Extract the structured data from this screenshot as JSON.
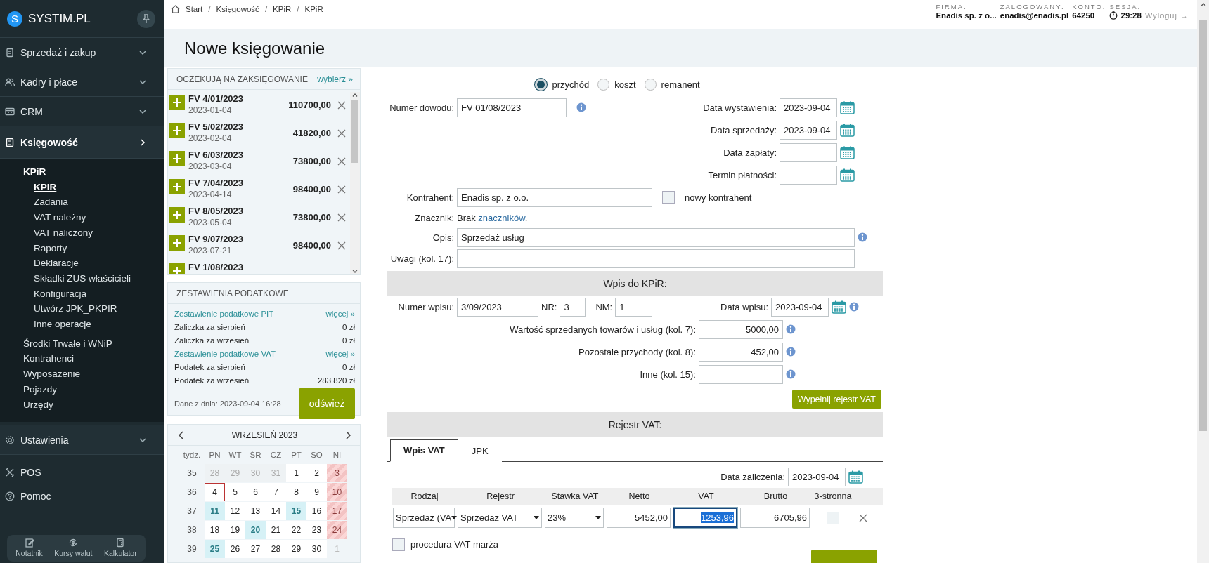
{
  "sidebar": {
    "logo": {
      "mark": "S",
      "name": "SYSTIM.PL"
    },
    "menu": [
      {
        "label": "Sprzedaż i zakup",
        "expanded": false
      },
      {
        "label": "Kadry i płace",
        "expanded": false
      },
      {
        "label": "CRM",
        "expanded": false
      },
      {
        "label": "Księgowość",
        "expanded": true,
        "children": [
          {
            "label": "KPiR",
            "selected": false,
            "children": [
              {
                "label": "KPiR",
                "selected": true
              },
              {
                "label": "Zadania",
                "selected": false
              },
              {
                "label": "VAT należny",
                "selected": false
              },
              {
                "label": "VAT naliczony",
                "selected": false
              },
              {
                "label": "Raporty",
                "selected": false
              },
              {
                "label": "Deklaracje",
                "selected": false
              },
              {
                "label": "Składki ZUS właścicieli",
                "selected": false
              },
              {
                "label": "Konfiguracja",
                "selected": false
              },
              {
                "label": "Utwórz JPK_PKPIR",
                "selected": false
              },
              {
                "label": "Inne operacje",
                "selected": false
              }
            ]
          },
          {
            "label": "Środki Trwałe i WNiP",
            "selected": false
          },
          {
            "label": "Kontrahenci",
            "selected": false
          },
          {
            "label": "Wyposażenie",
            "selected": false
          },
          {
            "label": "Pojazdy",
            "selected": false
          },
          {
            "label": "Urzędy",
            "selected": false
          }
        ]
      },
      {
        "label": "Ustawienia",
        "expanded": false
      }
    ],
    "links": [
      "POS",
      "Pomoc"
    ],
    "tools": [
      "Notatnik",
      "Kursy walut",
      "Kalkulator"
    ]
  },
  "header": {
    "breadcrumb": [
      "Start",
      "Księgowość",
      "KPiR",
      "KPiR"
    ],
    "separator": "/",
    "info": [
      {
        "label": "FIRMA:",
        "value": "Enadis sp. z o..."
      },
      {
        "label": "ZALOGOWANY:",
        "value": "enadis@enadis.pl"
      },
      {
        "label": "KONTO:",
        "value": "64250"
      },
      {
        "label": "SESJA:",
        "value": "29:28"
      }
    ],
    "logout": "Wyloguj →"
  },
  "title": "Nowe księgowanie",
  "pending": {
    "title": "OCZEKUJĄ NA ZAKSIĘGOWANIE",
    "link": "wybierz »",
    "items": [
      {
        "number": "FV 4/01/2023",
        "date": "2023-01-04",
        "amount": "110700,00"
      },
      {
        "number": "FV 5/02/2023",
        "date": "2023-02-04",
        "amount": "41820,00"
      },
      {
        "number": "FV 6/03/2023",
        "date": "2023-03-04",
        "amount": "73800,00"
      },
      {
        "number": "FV 7/04/2023",
        "date": "2023-04-14",
        "amount": "98400,00"
      },
      {
        "number": "FV 8/05/2023",
        "date": "2023-05-04",
        "amount": "73800,00"
      },
      {
        "number": "FV 9/07/2023",
        "date": "2023-07-21",
        "amount": "98400,00"
      },
      {
        "number": "FV 1/08/2023"
      }
    ]
  },
  "tax": {
    "title": "ZESTAWIENIA PODATKOWE",
    "rows": [
      {
        "kind": "link",
        "label": "Zestawienie podatkowe PIT",
        "value": "więcej »"
      },
      {
        "kind": "value",
        "label": "Zaliczka za sierpień",
        "value": "0 zł"
      },
      {
        "kind": "value",
        "label": "Zaliczka za wrzesień",
        "value": "0 zł"
      },
      {
        "kind": "link",
        "label": "Zestawienie podatkowe VAT",
        "value": "więcej »"
      },
      {
        "kind": "value",
        "label": "Podatek za sierpień",
        "value": "0 zł"
      },
      {
        "kind": "value",
        "label": "Podatek za wrzesień",
        "value": "283 820 zł"
      }
    ],
    "date": "Dane z dnia: 2023-09-04 16:28",
    "button": "odśwież"
  },
  "calendar": {
    "month": "WRZESIEŃ 2023",
    "headers": [
      "tydz.",
      "PN",
      "WT",
      "ŚR",
      "CZ",
      "PT",
      "SO",
      "NI"
    ],
    "weeks": [
      {
        "week": "35",
        "days": [
          {
            "d": "28",
            "kind": "other"
          },
          {
            "d": "29",
            "kind": "other"
          },
          {
            "d": "30",
            "kind": "other"
          },
          {
            "d": "31",
            "kind": "other"
          },
          {
            "d": "1",
            "kind": "normal"
          },
          {
            "d": "2",
            "kind": "normal"
          },
          {
            "d": "3",
            "kind": "holiday"
          }
        ]
      },
      {
        "week": "36",
        "days": [
          {
            "d": "4",
            "kind": "today"
          },
          {
            "d": "5",
            "kind": "normal"
          },
          {
            "d": "6",
            "kind": "normal"
          },
          {
            "d": "7",
            "kind": "normal"
          },
          {
            "d": "8",
            "kind": "normal"
          },
          {
            "d": "9",
            "kind": "normal"
          },
          {
            "d": "10",
            "kind": "holiday"
          }
        ]
      },
      {
        "week": "37",
        "days": [
          {
            "d": "11",
            "kind": "event"
          },
          {
            "d": "12",
            "kind": "normal"
          },
          {
            "d": "13",
            "kind": "normal"
          },
          {
            "d": "14",
            "kind": "normal"
          },
          {
            "d": "15",
            "kind": "event"
          },
          {
            "d": "16",
            "kind": "normal"
          },
          {
            "d": "17",
            "kind": "holiday"
          }
        ]
      },
      {
        "week": "38",
        "days": [
          {
            "d": "18",
            "kind": "normal"
          },
          {
            "d": "19",
            "kind": "normal"
          },
          {
            "d": "20",
            "kind": "event"
          },
          {
            "d": "21",
            "kind": "normal"
          },
          {
            "d": "22",
            "kind": "normal"
          },
          {
            "d": "23",
            "kind": "normal"
          },
          {
            "d": "24",
            "kind": "holiday"
          }
        ]
      },
      {
        "week": "39",
        "days": [
          {
            "d": "25",
            "kind": "event"
          },
          {
            "d": "26",
            "kind": "normal"
          },
          {
            "d": "27",
            "kind": "normal"
          },
          {
            "d": "28",
            "kind": "normal"
          },
          {
            "d": "29",
            "kind": "normal"
          },
          {
            "d": "30",
            "kind": "normal"
          },
          {
            "d": "1",
            "kind": "next"
          }
        ]
      }
    ]
  },
  "form": {
    "entry_type": [
      {
        "label": "przychód",
        "selected": true
      },
      {
        "label": "koszt",
        "selected": false
      },
      {
        "label": "remanent",
        "selected": false
      }
    ],
    "proof": {
      "label": "Numer dowodu:",
      "value": "FV 01/08/2023"
    },
    "dates": [
      {
        "label": "Data wystawienia:",
        "value": "2023-09-04"
      },
      {
        "label": "Data sprzedaży:",
        "value": "2023-09-04"
      },
      {
        "label": "Data zapłaty:"
      },
      {
        "label": "Termin płatności:"
      }
    ],
    "contractor": {
      "label": "Kontrahent:",
      "value": "Enadis sp. z o.o."
    },
    "new_contractor": {
      "label": "nowy kontrahent",
      "checked": false
    },
    "tag": {
      "label": "Znacznik:",
      "text": "Brak ",
      "link": "znaczników",
      "suffix": "."
    },
    "description": {
      "label": "Opis:",
      "value": "Sprzedaż usług"
    },
    "notes": {
      "label": "Uwagi (kol. 17):"
    },
    "kpir": {
      "title": "Wpis do KPiR:",
      "number": {
        "label": "Numer wpisu:",
        "value": "3/09/2023"
      },
      "nr": {
        "label": "NR:",
        "value": "3"
      },
      "nm": {
        "label": "NM:",
        "value": "1"
      },
      "date": {
        "label": "Data wpisu:",
        "value": "2023-09-04"
      },
      "amounts": [
        {
          "label": "Wartość sprzedanych towarów i usług (kol. 7):",
          "value": "5000,00"
        },
        {
          "label": "Pozostałe przychody (kol. 8):",
          "value": "452,00"
        },
        {
          "label": "Inne (kol. 15):"
        }
      ],
      "button": "Wypełnij rejestr VAT"
    },
    "vat": {
      "title": "Rejestr VAT:",
      "tabs": [
        {
          "label": "Wpis VAT",
          "selected": true
        },
        {
          "label": "JPK",
          "selected": false
        }
      ],
      "date": {
        "label": "Data zaliczenia:",
        "value": "2023-09-04"
      },
      "columns": [
        "Rodzaj",
        "Rejestr",
        "Stawka VAT",
        "Netto",
        "VAT",
        "Brutto",
        "3-stronna"
      ],
      "rows": [
        {
          "kind": "Sprzedaż (VA",
          "register": "Sprzedaż VAT",
          "rate": "23%",
          "net": "5452,00",
          "vat": "1253,96",
          "gross": "6705,96",
          "vat_focused": true,
          "three_party": false
        }
      ],
      "margin": {
        "label": "procedura VAT marża",
        "checked": false
      }
    }
  }
}
